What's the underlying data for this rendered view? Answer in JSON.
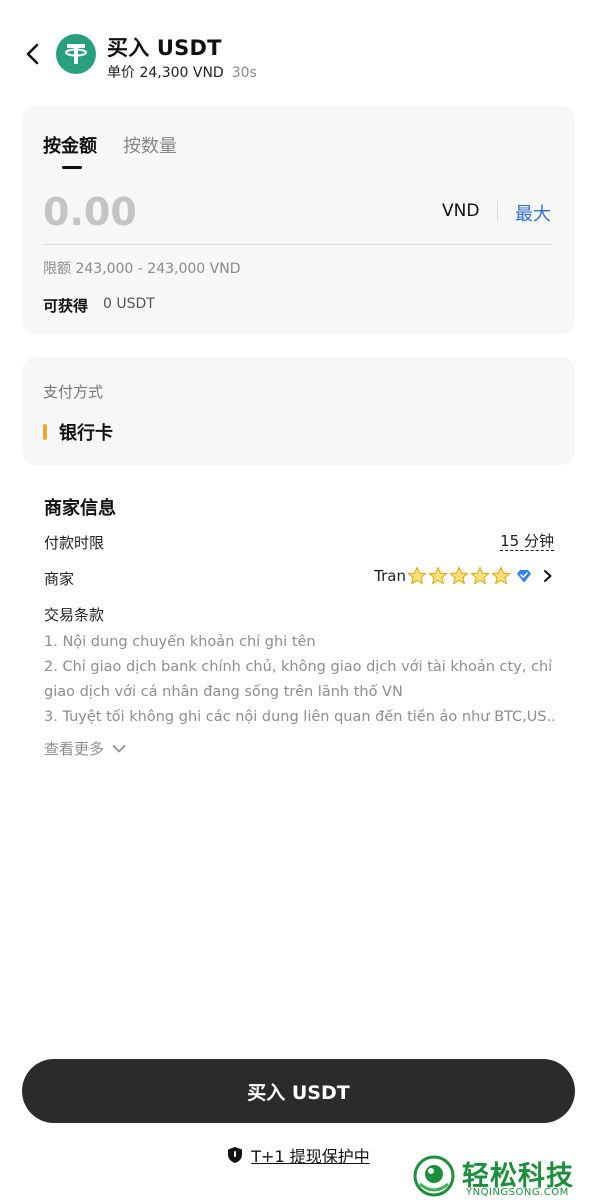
{
  "header": {
    "title": "买入 USDT",
    "price_text": "单价 24,300 VND",
    "countdown": "30s"
  },
  "amount_card": {
    "tabs": [
      {
        "label": "按金额",
        "active": true
      },
      {
        "label": "按数量",
        "active": false
      }
    ],
    "amount_placeholder": "0.00",
    "currency": "VND",
    "max_label": "最大",
    "limit_text": "限额 243,000 - 243,000 VND",
    "obtain_label": "可获得",
    "obtain_value": "0 USDT"
  },
  "payment": {
    "title": "支付方式",
    "method": "银行卡"
  },
  "merchant_info": {
    "title": "商家信息",
    "payment_time_label": "付款时限",
    "payment_time_value": "15 分钟",
    "merchant_label": "商家",
    "merchant_name": "Tran",
    "star_count": 5,
    "terms_label": "交易条款",
    "terms_lines": [
      "1. Nội dung chuyển khoản chỉ ghi tên",
      "2. Chỉ giao dịch bank chính chủ, không giao dịch với tài khoản cty, chỉ",
      "giao dịch với cá nhân đang sống trên lãnh thổ VN",
      "3. Tuyệt tối không ghi các nội dung liên quan đến tiền ảo như BTC,US..."
    ],
    "see_more_label": "查看更多"
  },
  "footer": {
    "buy_button_label": "买入 USDT",
    "protection_text": "T+1 提现保护中"
  },
  "watermark": {
    "brand": "轻松科技",
    "url": "YNQINGSONG.COM"
  },
  "colors": {
    "accent_blue": "#2f6fd6",
    "usdt_green": "#26a17b",
    "payment_bar_orange": "#f5a623",
    "button_dark": "#2b2b2e"
  }
}
